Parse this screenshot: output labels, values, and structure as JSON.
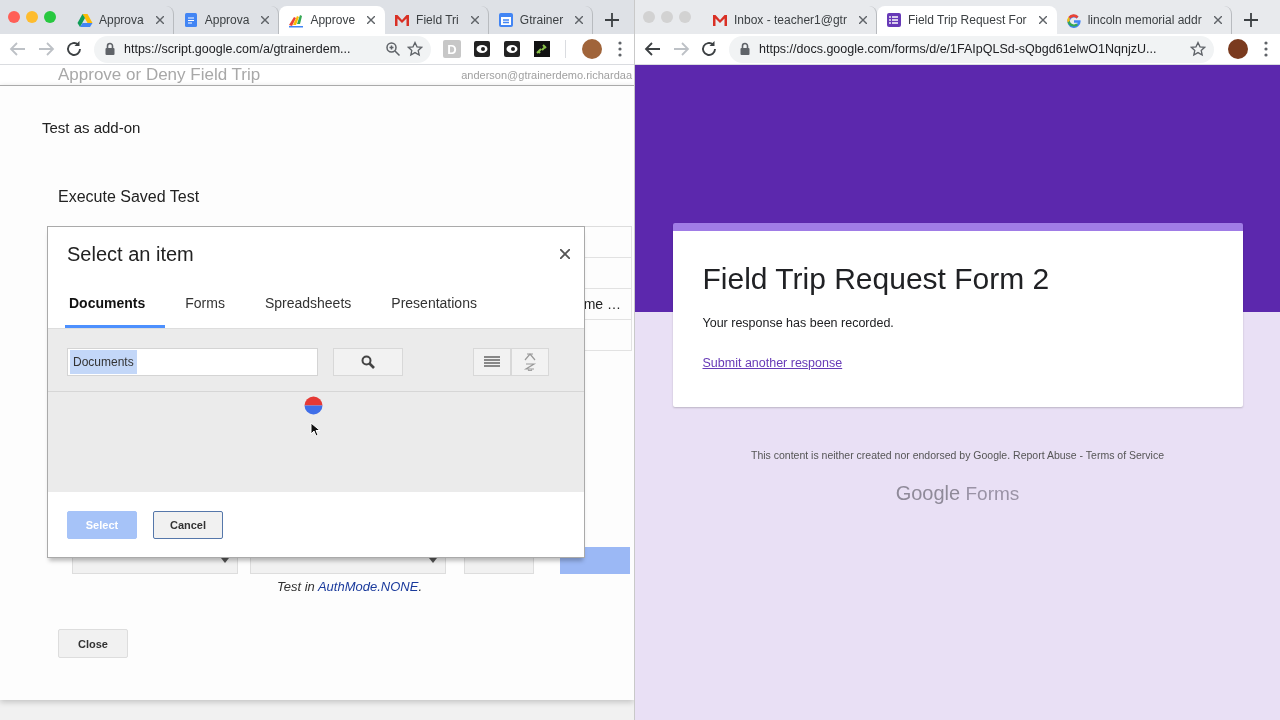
{
  "left_window": {
    "focused": true,
    "tabs": [
      {
        "kind": "drive",
        "label": "Approva",
        "selected": false
      },
      {
        "kind": "doc",
        "label": "Approva",
        "selected": false
      },
      {
        "kind": "script",
        "label": "Approve",
        "selected": true
      },
      {
        "kind": "mail",
        "label": "Field Tri",
        "selected": false
      },
      {
        "kind": "calendar",
        "label": "Gtrainer",
        "selected": false
      }
    ],
    "toolbar": {
      "back_disabled": true,
      "forward_disabled": true,
      "url": "https://script.google.com/a/gtrainerdem...",
      "zoom_icon": true,
      "extensions": [
        {
          "kind": "letter",
          "text": "D"
        },
        {
          "kind": "eye"
        },
        {
          "kind": "eye"
        },
        {
          "kind": "link"
        }
      ]
    },
    "page_behind": {
      "title": "Approve or Deny Field Trip",
      "account": "anderson@gtrainerdemo.richardaa"
    },
    "addon_dialog": {
      "title": "Test as add-on",
      "section": "Execute Saved Test",
      "cut_cell": "me …",
      "auth_note": {
        "prefix": "Test in ",
        "link": "AuthMode.NONE",
        "suffix": "."
      },
      "close_button": "Close"
    },
    "picker": {
      "title": "Select an item",
      "tabs": [
        {
          "label": "Documents",
          "selected": true
        },
        {
          "label": "Forms",
          "selected": false
        },
        {
          "label": "Spreadsheets",
          "selected": false
        },
        {
          "label": "Presentations",
          "selected": false
        }
      ],
      "search": {
        "value": "Documents",
        "value_selected": true
      },
      "loading": true,
      "buttons": [
        {
          "label": "Select",
          "disabled": true
        },
        {
          "label": "Cancel",
          "disabled": false
        }
      ]
    }
  },
  "right_window": {
    "focused": false,
    "tabs": [
      {
        "kind": "mail",
        "label": "Inbox - teacher1@gtr",
        "selected": false
      },
      {
        "kind": "form",
        "label": "Field Trip Request For",
        "selected": true
      },
      {
        "kind": "search",
        "label": "lincoln memorial addr",
        "selected": false
      }
    ],
    "toolbar": {
      "back_disabled": false,
      "forward_disabled": true,
      "url": "https://docs.google.com/forms/d/e/1FAIpQLSd-sQbgd61elwO1NqnjzU..."
    },
    "form": {
      "title": "Field Trip Request Form 2",
      "message": "Your response has been recorded.",
      "link": "Submit another response"
    },
    "footer": {
      "text": "This content is neither created nor endorsed by Google.",
      "links": [
        "Report Abuse",
        "Terms of Service"
      ],
      "separator": "-"
    },
    "logo": {
      "brand": "Google",
      "product": "Forms"
    }
  }
}
